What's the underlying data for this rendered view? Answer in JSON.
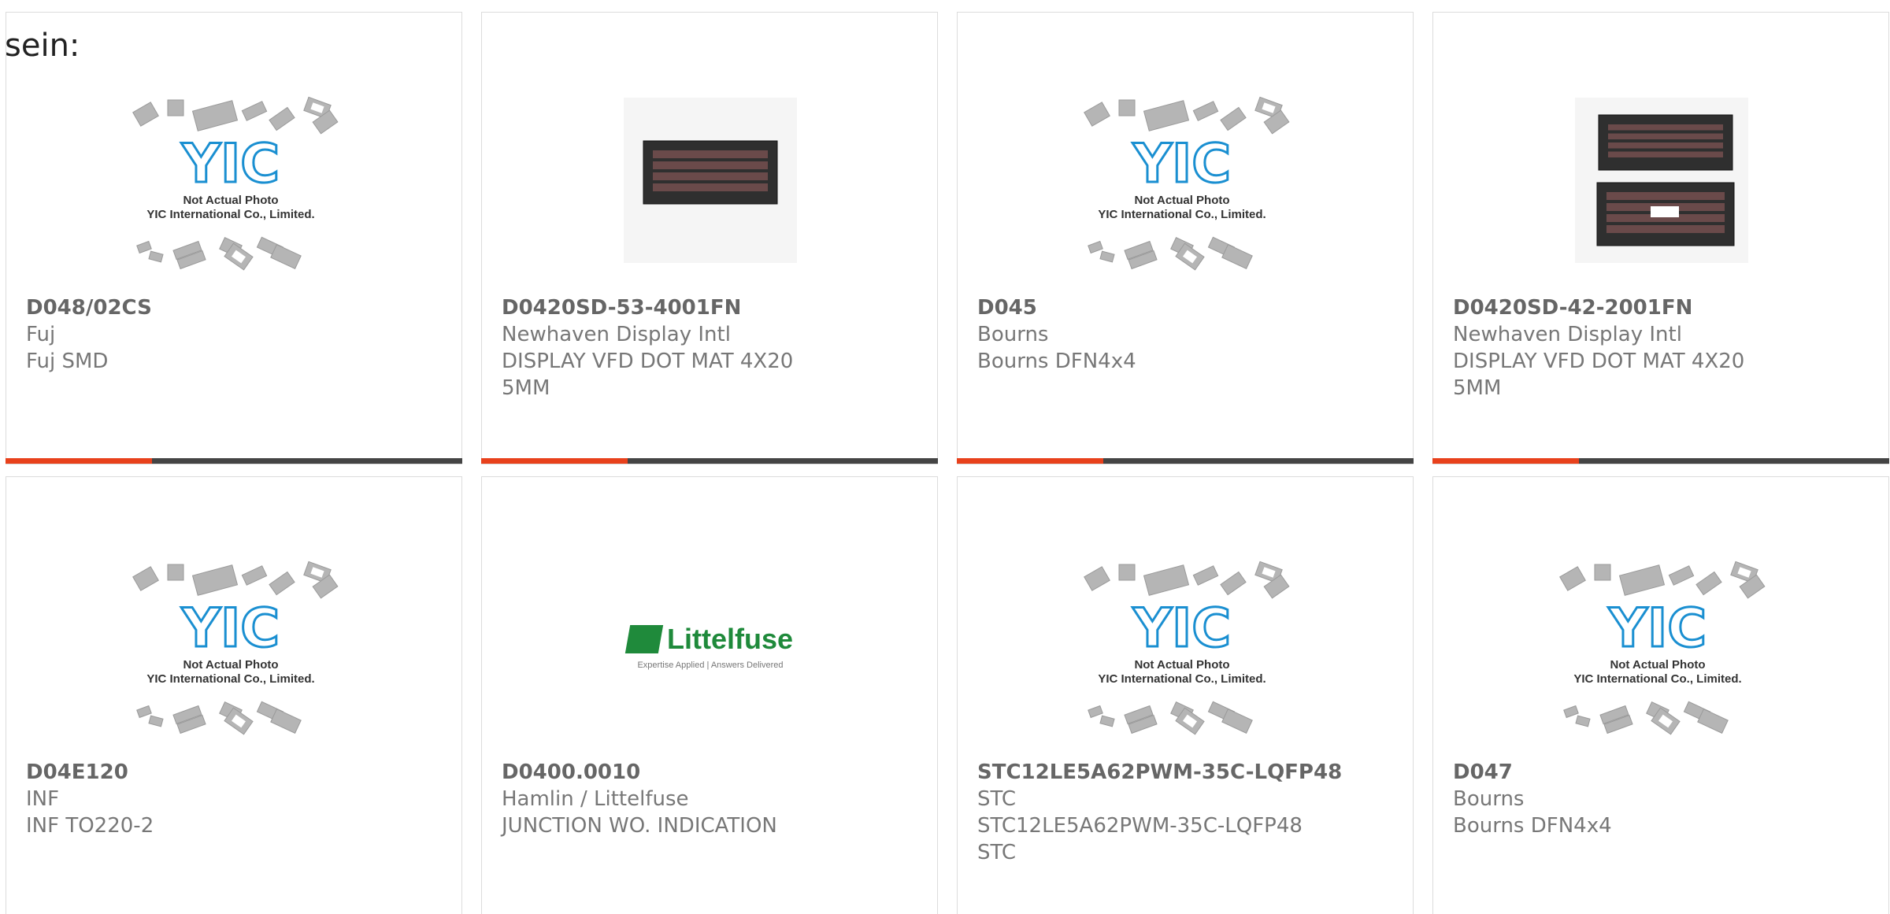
{
  "prefix": "sein:",
  "colors": {
    "accent": "#e8411c",
    "bar": "#444444",
    "yic_blue": "#1a8fd1",
    "littelfuse_green": "#1f8a3b"
  },
  "placeholder_image": {
    "line1": "Not Actual Photo",
    "line2": "YIC International Co., Limited.",
    "logo": "YIC"
  },
  "littelfuse_logo": {
    "name": "Littelfuse",
    "tagline": "Expertise Applied | Answers Delivered"
  },
  "products": [
    {
      "part": "D048/02CS",
      "maker": "Fuj",
      "lines": [
        "Fuj SMD"
      ],
      "image": "placeholder",
      "progress": 0.32
    },
    {
      "part": "D0420SD-53-4001FN",
      "maker": "Newhaven Display Intl",
      "lines": [
        "DISPLAY VFD DOT MAT 4X20",
        "5MM"
      ],
      "image": "vfd-module",
      "progress": 0.32
    },
    {
      "part": "D045",
      "maker": "Bourns",
      "lines": [
        "Bourns DFN4x4"
      ],
      "image": "placeholder",
      "progress": 0.32
    },
    {
      "part": "D0420SD-42-2001FN",
      "maker": "Newhaven Display Intl",
      "lines": [
        "DISPLAY VFD DOT MAT 4X20",
        "5MM"
      ],
      "image": "vfd-module-pair",
      "progress": 0.32
    },
    {
      "part": "D04E120",
      "maker": "INF",
      "lines": [
        "INF TO220-2"
      ],
      "image": "placeholder"
    },
    {
      "part": "D0400.0010",
      "maker": "Hamlin / Littelfuse",
      "lines": [
        "JUNCTION WO. INDICATION"
      ],
      "image": "littelfuse-logo"
    },
    {
      "part": "STC12LE5A62PWM-35C-LQFP48",
      "maker": "STC",
      "lines": [
        "STC12LE5A62PWM-35C-LQFP48",
        "STC"
      ],
      "image": "placeholder"
    },
    {
      "part": "D047",
      "maker": "Bourns",
      "lines": [
        "Bourns DFN4x4"
      ],
      "image": "placeholder"
    }
  ]
}
